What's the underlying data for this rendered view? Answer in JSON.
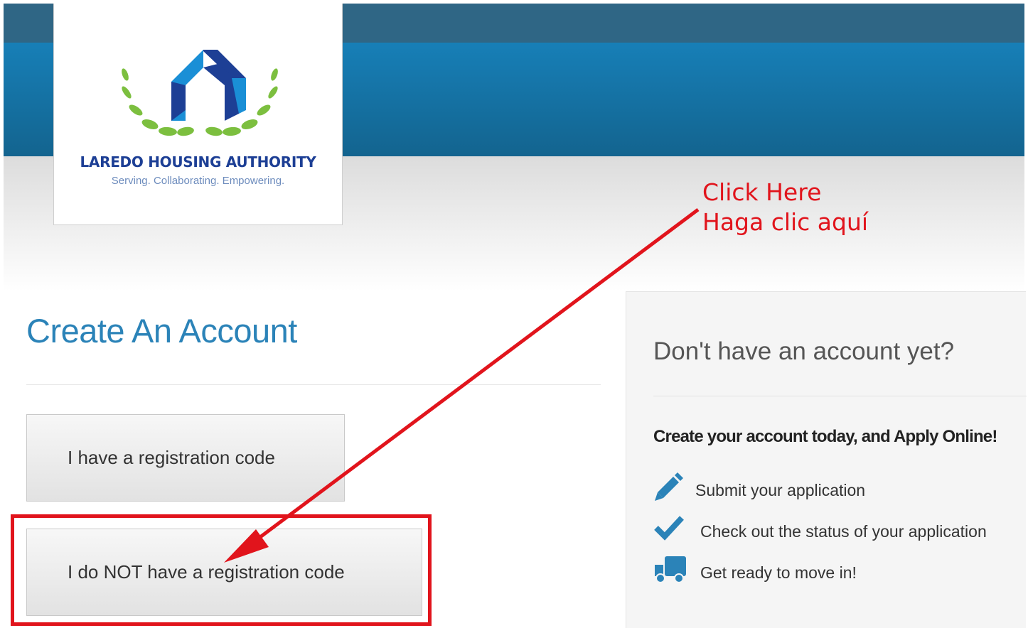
{
  "header": {
    "org_name": "LAREDO HOUSING AUTHORITY",
    "org_tagline": "Serving. Collaborating. Empowering."
  },
  "annotation": {
    "line1": "Click Here",
    "line2": "Haga clic aquí",
    "color": "#e1141c"
  },
  "main": {
    "title": "Create An Account",
    "btn_have_code": "I have a registration code",
    "btn_no_code": "I do NOT have a registration code"
  },
  "sidebar": {
    "title": "Don't have an account yet?",
    "subtitle": "Create your account today, and Apply Online!",
    "features": [
      {
        "icon": "pencil-icon",
        "label": "Submit your application"
      },
      {
        "icon": "checkmark-icon",
        "label": "Check out the status of your application"
      },
      {
        "icon": "truck-icon",
        "label": "Get ready to move in!"
      }
    ]
  },
  "colors": {
    "brand_blue": "#2b83b8",
    "banner_blue": "#177fb7",
    "icon_blue": "#2b83b8"
  }
}
